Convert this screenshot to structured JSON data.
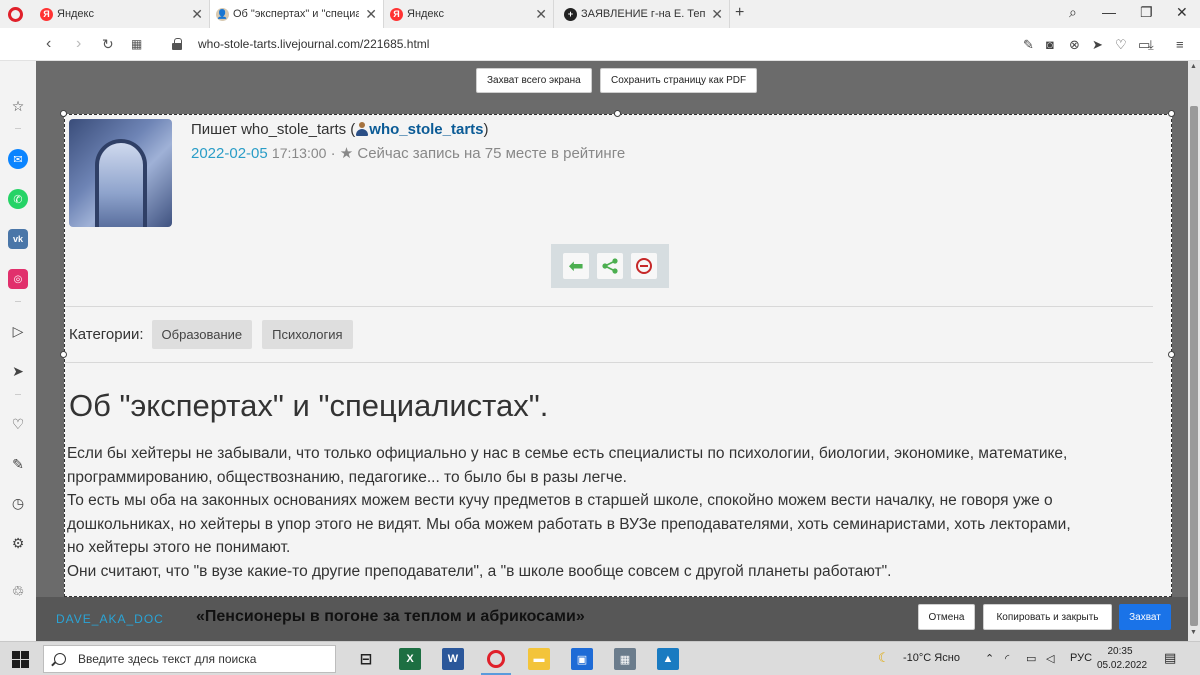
{
  "browser": {
    "tabs": [
      {
        "title": "Яндекс",
        "favicon": "yandex-icon"
      },
      {
        "title": "Об \"экспертах\" и \"специалистах\"",
        "favicon": "livejournal-user-icon",
        "active": true
      },
      {
        "title": "Яндекс",
        "favicon": "yandex-icon"
      },
      {
        "title": "ЗАЯВЛЕНИЕ г-на Е. Теплякова",
        "favicon": "plus-circle-icon"
      }
    ],
    "url": "who-stole-tarts.livejournal.com/221685.html"
  },
  "capture_toolbar": {
    "full_screen_label": "Захват всего экрана",
    "save_pdf_label": "Сохранить страницу как PDF"
  },
  "post": {
    "author_prefix": "Пишет who_stole_tarts (",
    "author_username": "who_stole_tarts",
    "author_suffix": ")",
    "date": "2022-02-05",
    "time": "17:13:00",
    "separator": " · ",
    "rating_text": "Сейчас запись на 75 месте в рейтинге",
    "categories_label": "Категории:",
    "categories": [
      "Образование",
      "Психология"
    ],
    "title": "Об \"экспертах\" и \"специалистах\".",
    "body_lines": [
      "Если бы хейтеры не забывали, что только официально у нас в семье есть специалисты по психологии, биологии, экономике, математике,",
      "программированию, обществознанию, педагогике... то было бы в разы легче.",
      "То есть мы оба на законных основаниях можем вести кучу предметов в старшей школе, спокойно можем вести началку, не говоря уже о",
      "дошкольниках, но хейтеры в упор этого не видят. Мы оба можем работать в ВУЗе преподавателями, хоть семинаристами, хоть лекторами,",
      "но хейтеры этого не понимают.",
      "Они считают, что \"в вузе какие-то другие преподаватели\", а \"в школе вообще совсем с другой планеты работают\"."
    ]
  },
  "bottom_strip": {
    "source": "DAVE_AKA_DOC",
    "headline": "«Пенсионеры в погоне за теплом и абрикосами»",
    "cancel_label": "Отмена",
    "copy_close_label": "Копировать и закрыть",
    "capture_label": "Захват"
  },
  "taskbar": {
    "search_placeholder": "Введите здесь текст для поиска",
    "weather": "-10°C  Ясно",
    "language": "РУС",
    "time": "20:35",
    "date": "05.02.2022"
  },
  "colors": {
    "accent_blue": "#1a73e8",
    "date_blue": "#2a9dc7",
    "username_blue": "#0b5b96",
    "opera_red": "#e0202a",
    "share_green": "#4caf50",
    "ban_red": "#c62828"
  }
}
